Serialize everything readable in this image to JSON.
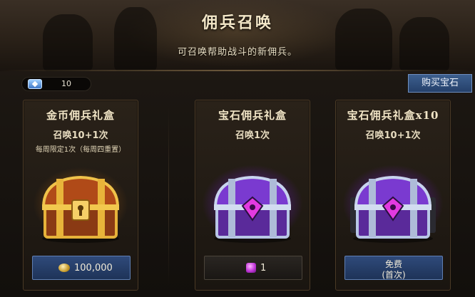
{
  "header": {
    "title": "佣兵召唤",
    "subtitle": "可召唤帮助战斗的新佣兵。"
  },
  "gem_counter": {
    "value": "10",
    "icon": "gem-icon"
  },
  "buy_gems_label": "购买宝石",
  "cards": [
    {
      "title": "金币佣兵礼盒",
      "summon": "召唤10+1次",
      "note": "每周限定1次（每周四重置）",
      "price": "100,000",
      "price_icon": "gold-coin-icon",
      "chest": "gold-chest"
    },
    {
      "title": "宝石佣兵礼盒",
      "summon": "召唤1次",
      "price": "1",
      "price_icon": "purple-gem-icon",
      "chest": "purple-chest"
    },
    {
      "title": "宝石佣兵礼盒x10",
      "summon": "召唤10+1次",
      "price_line1": "免费",
      "price_line2": "(首次)",
      "chest": "purple-chest"
    }
  ],
  "colors": {
    "gold_accent": "#e0a63a",
    "purple_accent": "#b25cf0",
    "button_blue": "#2f4a7a"
  }
}
